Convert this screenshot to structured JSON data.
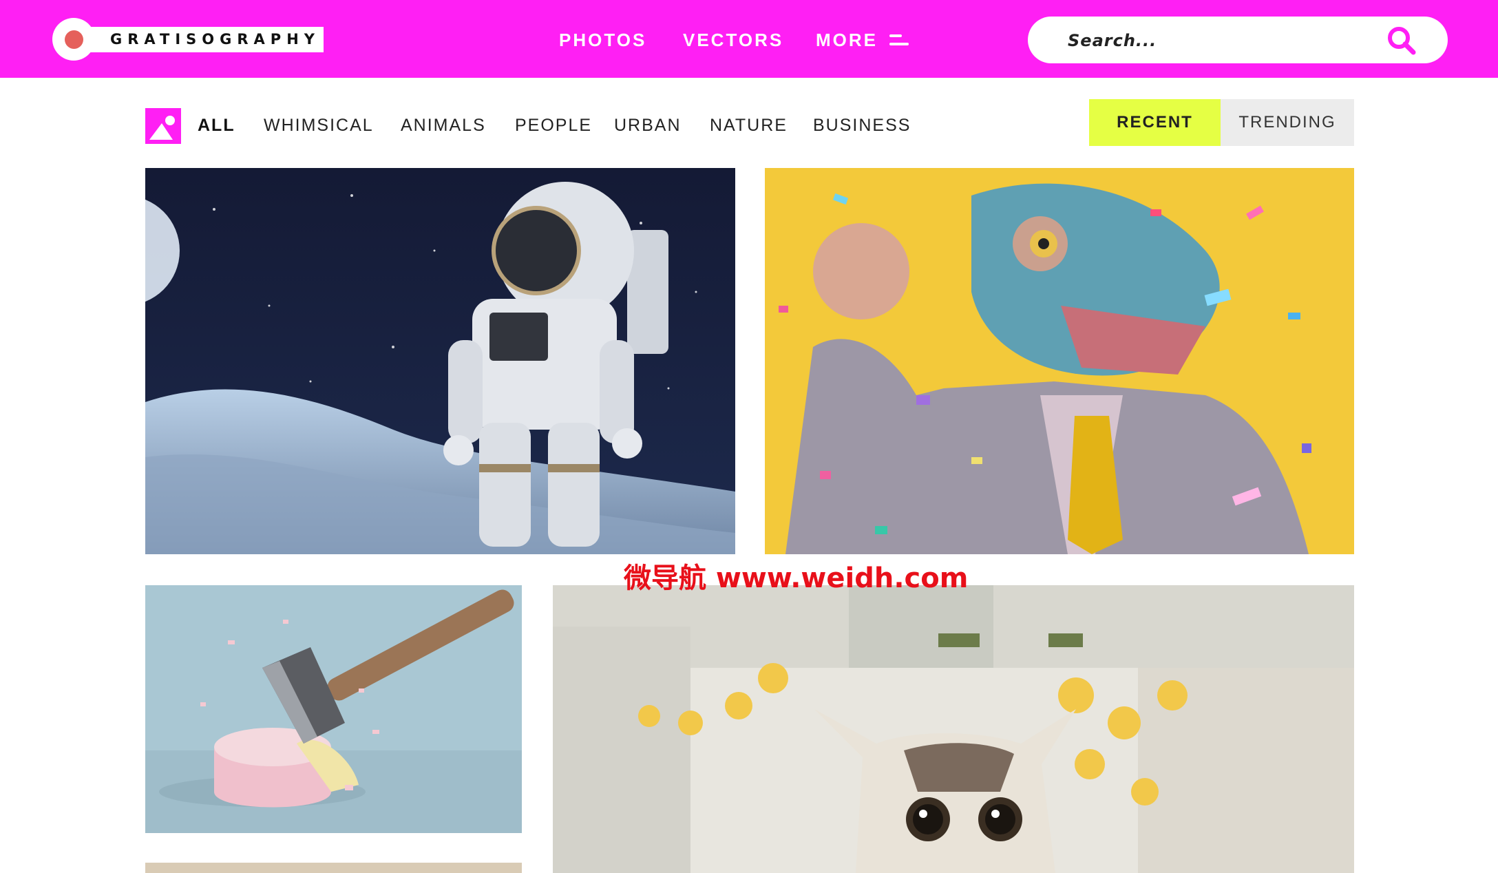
{
  "brand": {
    "name": "GRATISOGRAPHY"
  },
  "nav": {
    "photos": "PHOTOS",
    "vectors": "VECTORS",
    "more": "MORE"
  },
  "search": {
    "placeholder": "Search..."
  },
  "filters": [
    "ALL",
    "WHIMSICAL",
    "ANIMALS",
    "PEOPLE",
    "URBAN",
    "NATURE",
    "BUSINESS"
  ],
  "active_filter": "ALL",
  "sort": {
    "recent": "RECENT",
    "trending": "TRENDING",
    "active": "RECENT"
  },
  "photos": [
    {
      "name": "astronaut-on-moon"
    },
    {
      "name": "dinosaur-mask-man-with-confetti"
    },
    {
      "name": "axe-in-cake"
    },
    {
      "name": "cat-with-flowers"
    }
  ],
  "watermark": "微导航 www.weidh.com",
  "colors": {
    "brand": "#ff1ff4",
    "accent": "#e5ff44",
    "logo_dot": "#e5605b"
  }
}
